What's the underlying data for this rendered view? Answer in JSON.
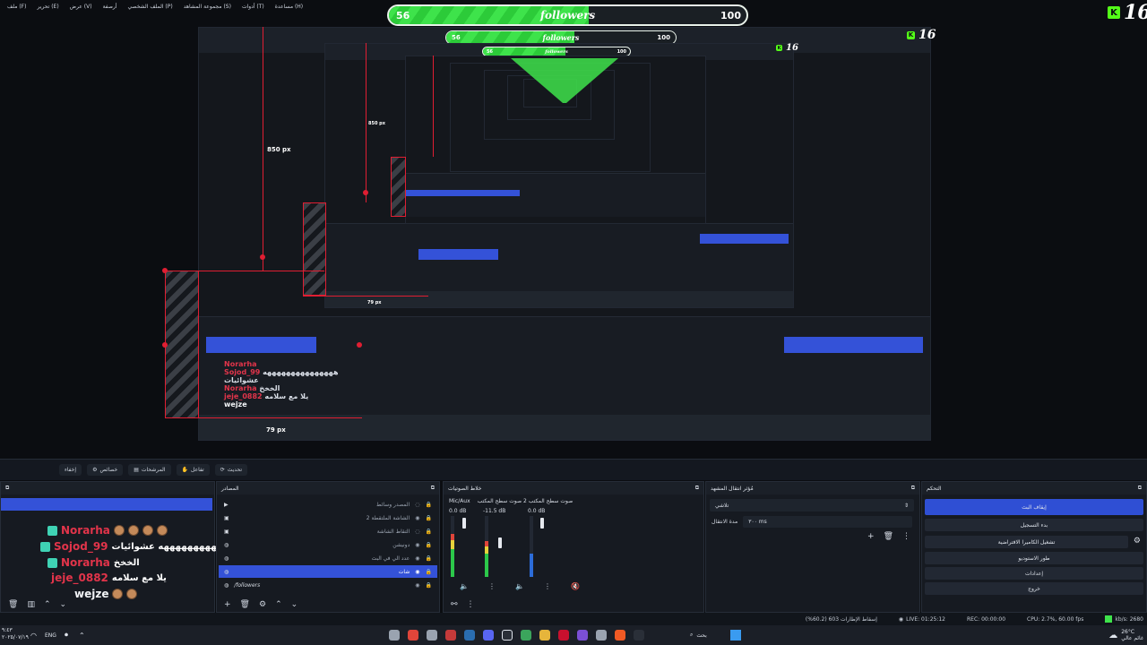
{
  "menu": [
    "ملف (F)",
    "تحرير (E)",
    "عرض (V)",
    "أرصفة",
    "الملف الشخصي (P)",
    "مجموعة المشاهد (S)",
    "أدوات (T)",
    "مساعدة (H)"
  ],
  "follower_goal": {
    "current": "56",
    "target": "100",
    "label": "followers",
    "progress": 0.56
  },
  "kick_badge": {
    "letter": "K",
    "number": "16"
  },
  "measure_labels": {
    "vertical_outer": "850 px",
    "vertical_inner": "850 px",
    "horizontal_mid": "79 px",
    "horizontal_bottom": "79 px"
  },
  "toolbar": {
    "refresh": "تحديث",
    "filters": "المرشحات",
    "interact": "تفاعل",
    "properties": "خصائص",
    "hide": "إخفاء"
  },
  "docks": {
    "chat_title": "",
    "sources_title": "المصادر",
    "mixer_title": "خلاط الصوتيات",
    "transitions_title": "مُؤثر انتقال المشهد",
    "controls_title": "التحكم"
  },
  "chat": [
    {
      "user": "Norarha",
      "color": "#e2344a",
      "message": ""
    },
    {
      "user": "Sojod_99",
      "color": "#e2344a",
      "message": "هههههههههههههههه عشوائيات"
    },
    {
      "user": "Norarha",
      "color": "#e2344a",
      "message": "الخخخ"
    },
    {
      "user": "jeje_0882",
      "color": "#e2344a",
      "message": "يلا مع سلامه"
    },
    {
      "user": "wejze",
      "color": "#f2f4f7",
      "message": ""
    }
  ],
  "sources": [
    {
      "name": "المصدر وسائط",
      "visible": false
    },
    {
      "name": "الشاشة الملتقطة 2",
      "visible": true
    },
    {
      "name": "التقاط الشاشة",
      "visible": false
    },
    {
      "name": "دونيشن",
      "visible": true
    },
    {
      "name": "عدد الي في البث",
      "visible": true
    },
    {
      "name": "شات",
      "visible": true,
      "selected": true
    },
    {
      "name": "/followers",
      "visible": true
    }
  ],
  "mixer": [
    {
      "name": "Mic/Aux",
      "db": "0.0 dB",
      "level": 0.2
    },
    {
      "name": "صوت سطح المكتب",
      "db": "-11.5 dB",
      "level": 0.55
    },
    {
      "name": "صوت سطح المكتب 2",
      "db": "0.0 dB",
      "level": 0.1
    }
  ],
  "mixer_header": "صوت سطح المكتب 2   صوت سطح المكتب",
  "transition": {
    "type": "تلاشي",
    "duration_label": "مدة الانتقال",
    "duration_value": "٣٠٠ ms"
  },
  "controls": [
    "إيقاف البث",
    "بدء التسجيل",
    "تشغيل الكاميرا الافتراضية",
    "طور الاستوديو",
    "إعدادات",
    "خروج"
  ],
  "status": {
    "dropped": "إسقاط الإطارات 603 (60.2%)",
    "live": "LIVE: 01:25:12",
    "rec": "REC: 00:00:00",
    "cpu": "CPU: 2.7%, 60.00 fps",
    "kbps": "kb/s: 2680"
  },
  "taskbar": {
    "lang": "ENG",
    "time": "٩:٤٣",
    "date": "٢٠٢٥/٠٧/١٩",
    "weather_temp": "26°C",
    "weather_label": "غائم عالي",
    "search": "بحث"
  }
}
